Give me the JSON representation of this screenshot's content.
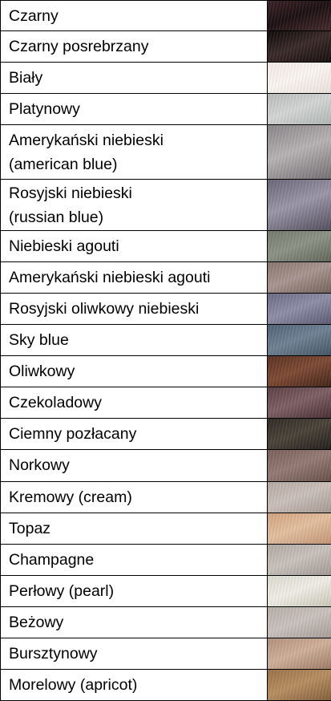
{
  "rows": [
    {
      "name": "Czarny",
      "swatch": "black-fur",
      "colors": [
        "#3a2226",
        "#1c1012",
        "#4a2c30"
      ]
    },
    {
      "name": "Czarny posrebrzany",
      "swatch": "silver-black-fur",
      "colors": [
        "#0e0a0a",
        "#3a2a28",
        "#120c0c"
      ]
    },
    {
      "name": "Biały",
      "swatch": "white-fur",
      "colors": [
        "#f3ebe6",
        "#fbf6f2",
        "#e9dfd8"
      ]
    },
    {
      "name": "Platynowy",
      "swatch": "platinum-fur",
      "colors": [
        "#b9bcbb",
        "#d3d6d5",
        "#aeb2b1"
      ]
    },
    {
      "name": "Amerykański niebieski\n(american blue)",
      "swatch": "american-blue-fur",
      "colors": [
        "#8a8588",
        "#b7b2b4",
        "#6f6a6d"
      ]
    },
    {
      "name": "Rosyjski  niebieski\n(russian blue)",
      "swatch": "russian-blue-fur",
      "colors": [
        "#6a6578",
        "#9a96a8",
        "#4d4858"
      ]
    },
    {
      "name": "Niebieski  agouti",
      "swatch": "blue-agouti-fur",
      "colors": [
        "#737b6c",
        "#8d9285",
        "#5a6154"
      ]
    },
    {
      "name": "Amerykański niebieski agouti",
      "swatch": "american-blue-agouti-fur",
      "colors": [
        "#8b7670",
        "#a89590",
        "#6e5b55"
      ]
    },
    {
      "name": "Rosyjski oliwkowy niebieski",
      "swatch": "russian-olive-blue-fur",
      "colors": [
        "#6b6a85",
        "#8f8ea8",
        "#55536e"
      ]
    },
    {
      "name": "Sky blue",
      "swatch": "sky-blue-fur",
      "colors": [
        "#4f6275",
        "#6e8294",
        "#3e4f60"
      ]
    },
    {
      "name": "Oliwkowy",
      "swatch": "olive-fur",
      "colors": [
        "#5a3122",
        "#7e4a33",
        "#3b1f16"
      ]
    },
    {
      "name": "Czekoladowy",
      "swatch": "chocolate-fur",
      "colors": [
        "#5b4046",
        "#7d5f65",
        "#43292f"
      ]
    },
    {
      "name": "Ciemny pozłacany",
      "swatch": "dark-gold-fur",
      "colors": [
        "#2e2a24",
        "#4a4339",
        "#1e1b17"
      ]
    },
    {
      "name": "Norkowy",
      "swatch": "mink-fur",
      "colors": [
        "#7a5f5a",
        "#957a74",
        "#624a45"
      ]
    },
    {
      "name": "Kremowy (cream)",
      "swatch": "cream-fur",
      "colors": [
        "#b6aaa3",
        "#cbc0ba",
        "#a0948d"
      ]
    },
    {
      "name": "Topaz",
      "swatch": "topaz-fur",
      "colors": [
        "#d2a47f",
        "#e3bf9f",
        "#bf9170"
      ]
    },
    {
      "name": "Champagne",
      "swatch": "champagne-fur",
      "colors": [
        "#b1a9a3",
        "#c9c2bc",
        "#9e958f"
      ]
    },
    {
      "name": "Perłowy (pearl)",
      "swatch": "pearl-fur",
      "colors": [
        "#dedbcf",
        "#f0eee6",
        "#c6c2b3"
      ]
    },
    {
      "name": "Beżowy",
      "swatch": "beige-fur",
      "colors": [
        "#b7aea8",
        "#cac2bd",
        "#a39993"
      ]
    },
    {
      "name": "Bursztynowy",
      "swatch": "amber-fur",
      "colors": [
        "#b2907a",
        "#cfb09a",
        "#98765f"
      ]
    },
    {
      "name": "Morelowy (apricot)",
      "swatch": "apricot-fur",
      "colors": [
        "#9a7148",
        "#b78e61",
        "#7d5a37"
      ]
    }
  ]
}
